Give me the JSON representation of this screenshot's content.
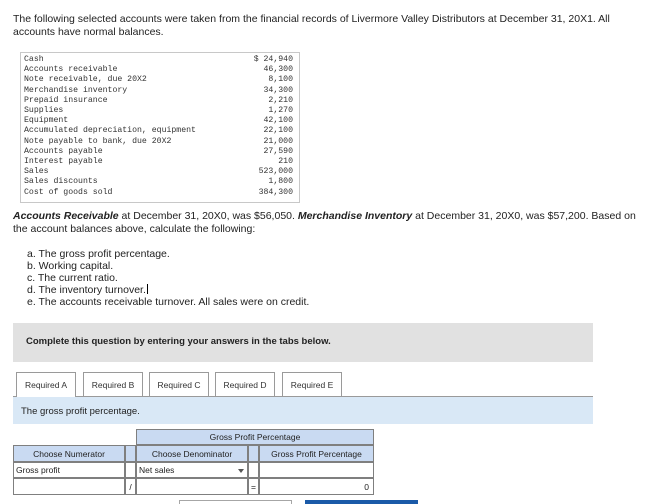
{
  "intro": "The following selected accounts were taken from the financial records of Livermore Valley Distributors at December 31, 20X1. All accounts have normal balances.",
  "accounts": [
    {
      "name": "Cash",
      "amount": "$ 24,940"
    },
    {
      "name": "Accounts receivable",
      "amount": "46,300"
    },
    {
      "name": "Note receivable, due 20X2",
      "amount": "8,100"
    },
    {
      "name": "Merchandise inventory",
      "amount": "34,300"
    },
    {
      "name": "Prepaid insurance",
      "amount": "2,210"
    },
    {
      "name": "Supplies",
      "amount": "1,270"
    },
    {
      "name": "Equipment",
      "amount": "42,100"
    },
    {
      "name": "Accumulated depreciation, equipment",
      "amount": "22,100"
    },
    {
      "name": "Note payable to bank, due 20X2",
      "amount": "21,000"
    },
    {
      "name": "Accounts payable",
      "amount": "27,590"
    },
    {
      "name": "Interest payable",
      "amount": "210"
    },
    {
      "name": "Sales",
      "amount": "523,000"
    },
    {
      "name": "Sales discounts",
      "amount": "1,800"
    },
    {
      "name": "Cost of goods sold",
      "amount": "384,300"
    }
  ],
  "info": {
    "ar_label": "Accounts Receivable",
    "ar_text": " at December 31, 20X0, was $56,050. ",
    "inv_label": "Merchandise Inventory",
    "inv_text": " at December 31, 20X0, was $57,200. Based on the account balances above, calculate the following:"
  },
  "requirements": [
    "a. The gross profit percentage.",
    "b. Working capital.",
    "c. The current ratio.",
    "d. The inventory turnover.",
    "e. The accounts receivable turnover. All sales were on credit."
  ],
  "banner": "Complete this question by entering your answers in the tabs below.",
  "tabs": [
    "Required A",
    "Required B",
    "Required C",
    "Required D",
    "Required E"
  ],
  "panel_title": "The gross profit percentage.",
  "grid": {
    "group_header": "Gross Profit Percentage",
    "col_numerator": "Choose Numerator",
    "col_denominator": "Choose Denominator",
    "col_result": "Gross Profit Percentage",
    "numerator_value": "Gross profit",
    "denominator_value": "Net sales",
    "divide_op": "/",
    "equals_op": "=",
    "result_value": "0"
  }
}
